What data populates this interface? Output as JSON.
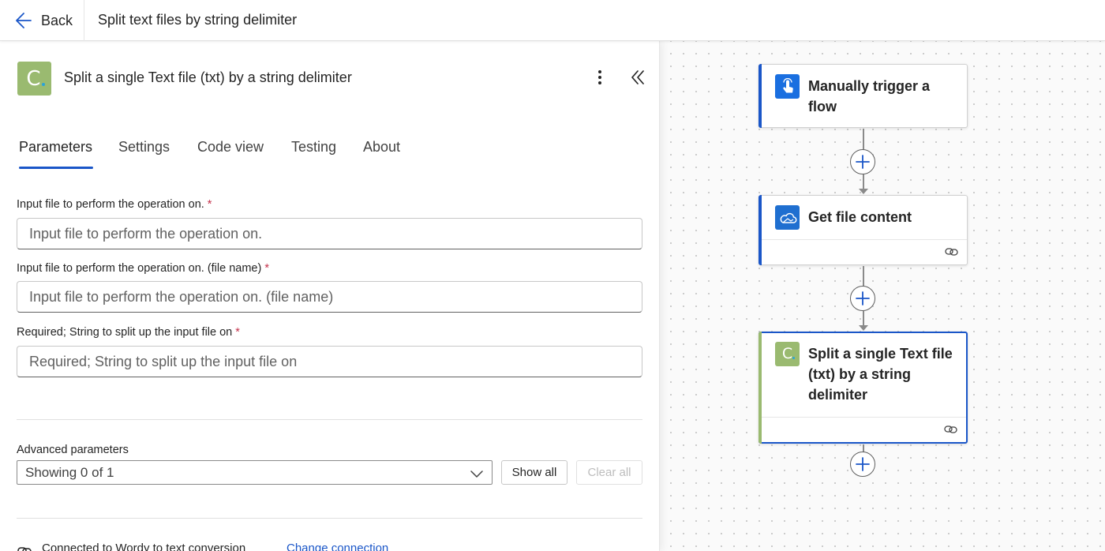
{
  "header": {
    "back_label": "Back",
    "flow_title": "Split text files by string delimiter"
  },
  "panel": {
    "title": "Split a single Text file (txt) by a string delimiter",
    "logo_letter": "C",
    "tabs": [
      {
        "label": "Parameters",
        "active": true
      },
      {
        "label": "Settings",
        "active": false
      },
      {
        "label": "Code view",
        "active": false
      },
      {
        "label": "Testing",
        "active": false
      },
      {
        "label": "About",
        "active": false
      }
    ],
    "fields": [
      {
        "label": "Input file to perform the operation on.",
        "required": "*",
        "placeholder": "Input file to perform the operation on.",
        "value": ""
      },
      {
        "label": "Input file to perform the operation on. (file name)",
        "required": "*",
        "placeholder": "Input file to perform the operation on. (file name)",
        "value": ""
      },
      {
        "label": "Required; String to split up the input file on",
        "required": "*",
        "placeholder": "Required; String to split up the input file on",
        "value": ""
      }
    ],
    "advanced": {
      "label": "Advanced parameters",
      "selected": "Showing 0 of 1",
      "show_all": "Show all",
      "clear_all": "Clear all"
    },
    "connection": {
      "text": "Connected to Wordy to text conversion",
      "change_link": "Change connection"
    }
  },
  "canvas": {
    "cards": [
      {
        "title_line1": "Manually trigger a",
        "title_line2": "flow",
        "icon": "touch-trigger-icon",
        "accent": "#1a56c8"
      },
      {
        "title_line1": "Get file content",
        "icon": "onedrive-cloud-icon",
        "accent": "#1a56c8"
      },
      {
        "title_line1": "Split a single Text file",
        "title_line2": "(txt) by a string",
        "title_line3": "delimiter",
        "icon": "connector-c-icon",
        "accent": "#9aba70",
        "logo_letter": "C"
      }
    ]
  },
  "colors": {
    "accent_blue": "#1a56c8",
    "connector_green": "#9aba70",
    "required_red": "#c4314b"
  }
}
